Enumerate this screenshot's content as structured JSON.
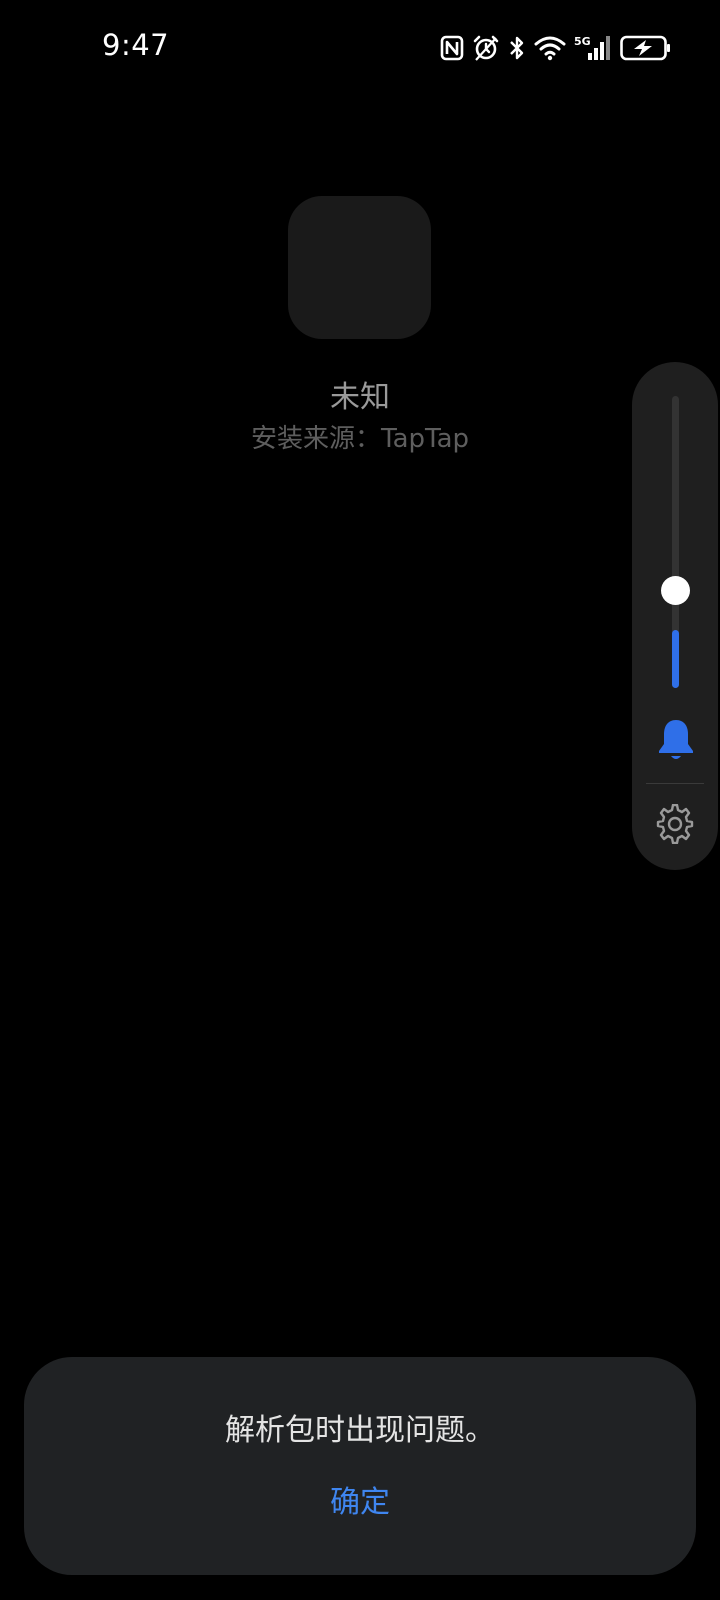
{
  "status_bar": {
    "time": "9:47",
    "icons": [
      "nfc-icon",
      "alarm-icon",
      "bluetooth-icon",
      "wifi-icon",
      "5g-signal-icon",
      "battery-charging-icon"
    ],
    "network_label": "5G"
  },
  "app": {
    "name": "未知",
    "install_source": "安装来源：TapTap"
  },
  "volume": {
    "level": 0.2,
    "mode_icon": "bell-icon",
    "settings_icon": "gear-icon",
    "accent_color": "#2f6fe8"
  },
  "dialog": {
    "message": "解析包时出现问题。",
    "confirm_label": "确定",
    "confirm_color": "#3f86f0"
  }
}
